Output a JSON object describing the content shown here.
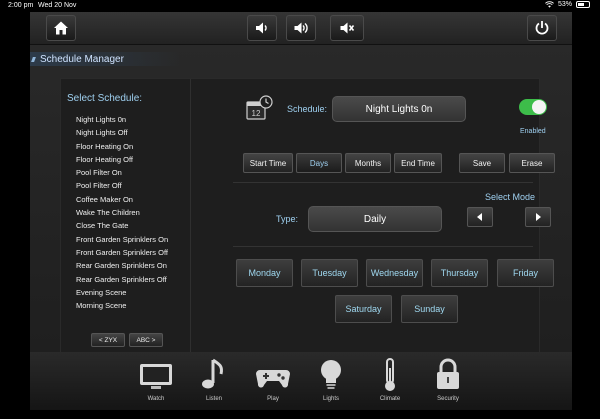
{
  "status_bar": {
    "time": "2:00 pm",
    "date": "Wed 20 Nov",
    "battery": "53%"
  },
  "top_bar": {
    "home_icon": "home-icon",
    "volume_down_icon": "volume-down-icon",
    "volume_up_icon": "volume-up-icon",
    "mute_icon": "mute-icon",
    "power_icon": "power-icon"
  },
  "section_title": "Schedule Manager",
  "schedule_list": {
    "title": "Select Schedule:",
    "items": [
      "Night Lights 0n",
      "Night Lights Off",
      "Floor Heating On",
      "Floor Heating Off",
      "Pool Filter On",
      "Pool Filter Off",
      "Coffee Maker On",
      "Wake The Children",
      "Close The Gate",
      "Front Garden Sprinklers On",
      "Front Garden Sprinklers Off",
      "Rear Garden Sprinklers On",
      "Rear Garden Sprinklers Off",
      "Evening Scene",
      "Morning Scene"
    ],
    "sort_desc": "< ZYX",
    "sort_asc": "ABC >"
  },
  "editor": {
    "schedule_label": "Schedule:",
    "schedule_name": "Night Lights 0n",
    "enabled_label": "Enabled",
    "enabled": true,
    "buttons": {
      "start_time": "Start Time",
      "days": "Days",
      "months": "Months",
      "end_time": "End Time",
      "save": "Save",
      "erase": "Erase"
    },
    "type_label": "Type:",
    "type_value": "Daily",
    "select_mode_label": "Select Mode",
    "days": [
      "Monday",
      "Tuesday",
      "Wednesday",
      "Thursday",
      "Friday",
      "Saturday",
      "Sunday"
    ]
  },
  "dock": [
    {
      "label": "Watch",
      "icon": "tv-icon"
    },
    {
      "label": "Listen",
      "icon": "music-note-icon"
    },
    {
      "label": "Play",
      "icon": "gamepad-icon"
    },
    {
      "label": "Lights",
      "icon": "lightbulb-icon"
    },
    {
      "label": "Climate",
      "icon": "thermometer-icon"
    },
    {
      "label": "Security",
      "icon": "padlock-icon"
    }
  ],
  "colors": {
    "accent_text": "#9fd0f0",
    "toggle_on": "#3dbd4a",
    "background": "#1e1e1e"
  }
}
